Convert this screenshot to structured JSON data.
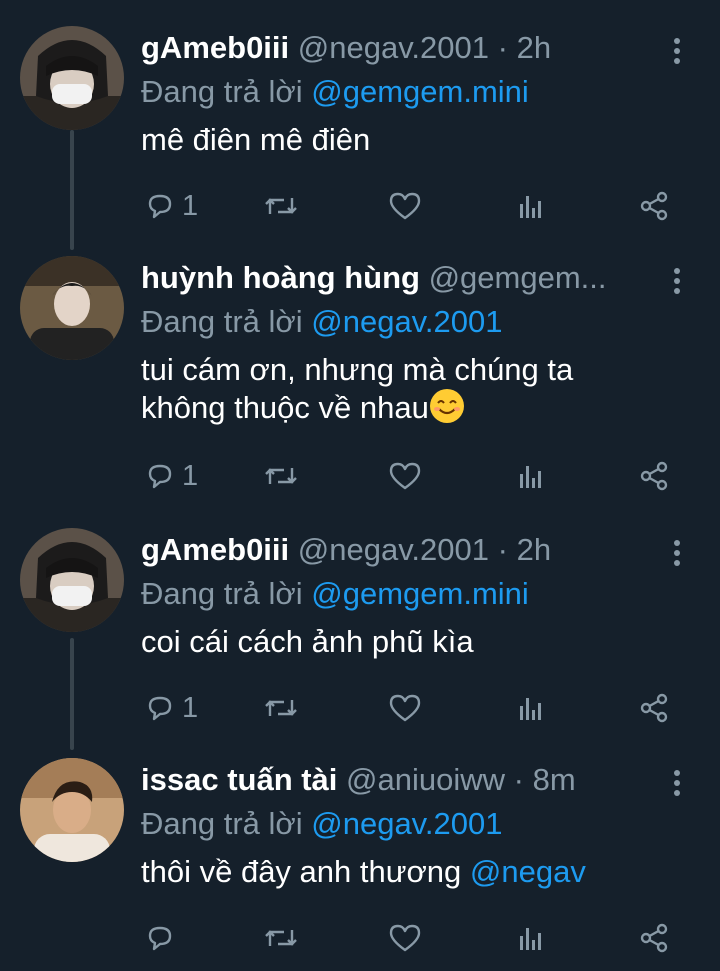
{
  "tweets": [
    {
      "name": "gAmeb0iii",
      "handle": "@negav.2001",
      "dot": "·",
      "time": "2h",
      "reply_prefix": "Đang trả lời",
      "reply_to": "@gemgem.mini",
      "text": "mê điên mê điên",
      "reply_count": "1"
    },
    {
      "name": "huỳnh hoàng hùng",
      "handle": "@gemgem...",
      "reply_prefix": "Đang trả lời",
      "reply_to": "@negav.2001",
      "text_line1": "tui cám ơn, nhưng mà chúng ta",
      "text_line2": "không thuộc về nhau",
      "emoji": "smiling-face-emoji",
      "reply_count": "1"
    },
    {
      "name": "gAmeb0iii",
      "handle": "@negav.2001",
      "dot": "·",
      "time": "2h",
      "reply_prefix": "Đang trả lời",
      "reply_to": "@gemgem.mini",
      "text": "coi cái cách ảnh phũ kìa",
      "reply_count": "1"
    },
    {
      "name": "issac tuấn tài",
      "handle": "@aniuoiww",
      "dot": "·",
      "time": "8m",
      "reply_prefix": "Đang trả lời",
      "reply_to": "@negav.2001",
      "text": "thôi về đây anh thương ",
      "mention": "@negav",
      "reply_count": ""
    }
  ],
  "icons": {
    "reply": "reply-icon",
    "retweet": "retweet-icon",
    "like": "heart-icon",
    "views": "views-icon",
    "share": "share-icon",
    "more": "more-vertical-icon"
  },
  "colors": {
    "background": "#15202b",
    "text": "#ffffff",
    "secondary": "#8899a6",
    "link": "#1d9bf0",
    "thread_line": "#38444d"
  }
}
